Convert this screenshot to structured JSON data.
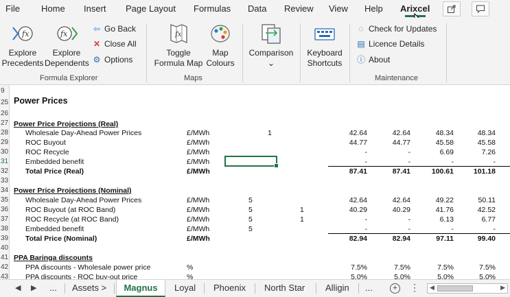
{
  "menu": {
    "tabs": [
      "File",
      "Home",
      "Insert",
      "Page Layout",
      "Formulas",
      "Data",
      "Review",
      "View",
      "Help",
      "Arixcel"
    ],
    "active": "Arixcel"
  },
  "ribbon": {
    "formula_explorer": {
      "explore_precedents": [
        "Explore",
        "Precedents"
      ],
      "explore_dependents": [
        "Explore",
        "Dependents"
      ],
      "go_back": "Go Back",
      "close_all": "Close All",
      "options": "Options",
      "group_label": "Formula Explorer"
    },
    "maps": {
      "toggle_formula_map": [
        "Toggle",
        "Formula Map"
      ],
      "map_colours": [
        "Map",
        "Colours"
      ],
      "group_label": "Maps"
    },
    "comparison": {
      "label": "Comparison",
      "arrow": "⌄"
    },
    "keyboard_shortcuts": [
      "Keyboard",
      "Shortcuts"
    ],
    "maintenance": {
      "check_updates": "Check for Updates",
      "licence_details": "Licence Details",
      "about": "About",
      "group_label": "Maintenance"
    }
  },
  "sheet": {
    "rows": [
      {
        "num": "9"
      },
      {
        "num": "25",
        "label": "Power Prices",
        "style": "bold-title"
      },
      {
        "num": "26"
      },
      {
        "num": "27",
        "label": "Power Price Projections (Real)",
        "style": "section"
      },
      {
        "num": "28",
        "label": "Wholesale Day-Ahead Power Prices",
        "unit": "£/MWh",
        "c1": "1",
        "v": [
          "42.64",
          "42.64",
          "48.34",
          "48.34"
        ]
      },
      {
        "num": "29",
        "label": "ROC Buyout",
        "unit": "£/MWh",
        "v": [
          "44.77",
          "44.77",
          "45.58",
          "45.58"
        ]
      },
      {
        "num": "30",
        "label": "ROC Recycle",
        "unit": "£/MWh",
        "v": [
          "-",
          "-",
          "6.69",
          "7.26"
        ]
      },
      {
        "num": "31",
        "label": "Embedded benefit",
        "unit": "£/MWh",
        "v": [
          "-",
          "-",
          "-",
          "-"
        ]
      },
      {
        "num": "32",
        "label": "Total Price (Real)",
        "unit": "£/MWh",
        "style": "total",
        "v": [
          "87.41",
          "87.41",
          "100.61",
          "101.18"
        ]
      },
      {
        "num": "33"
      },
      {
        "num": "34",
        "label": "Power Price Projections (Nominal)",
        "style": "section"
      },
      {
        "num": "35",
        "label": "Wholesale Day-Ahead Power Prices",
        "unit": "£/MWh",
        "c2": "5",
        "v": [
          "42.64",
          "42.64",
          "49.22",
          "50.11"
        ]
      },
      {
        "num": "36",
        "label": "ROC Buyout (at ROC Band)",
        "unit": "£/MWh",
        "c2": "5",
        "c3": "1",
        "v": [
          "40.29",
          "40.29",
          "41.76",
          "42.52"
        ]
      },
      {
        "num": "37",
        "label": "ROC Recycle (at ROC Band)",
        "unit": "£/MWh",
        "c2": "5",
        "c3": "1",
        "v": [
          "-",
          "-",
          "6.13",
          "6.77"
        ]
      },
      {
        "num": "38",
        "label": "Embedded benefit",
        "unit": "£/MWh",
        "c2": "5",
        "v": [
          "-",
          "-",
          "-",
          "-"
        ]
      },
      {
        "num": "39",
        "label": "Total Price (Nominal)",
        "unit": "£/MWh",
        "style": "total",
        "v": [
          "82.94",
          "82.94",
          "97.11",
          "99.40"
        ]
      },
      {
        "num": "40"
      },
      {
        "num": "41",
        "label": "PPA Baringa discounts",
        "style": "section"
      },
      {
        "num": "42",
        "label": "PPA discounts - Wholesale power price",
        "unit": "%",
        "v": [
          "7.5%",
          "7.5%",
          "7.5%",
          "7.5%"
        ]
      },
      {
        "num": "43",
        "label": "PPA discounts - ROC buy-out price",
        "unit": "%",
        "v": [
          "5.0%",
          "5.0%",
          "5.0%",
          "5.0%"
        ]
      }
    ]
  },
  "tabs": {
    "ellipsis": "...",
    "sheets": [
      "Assets >",
      "Magnus",
      "Loyal",
      "Phoenix",
      "North Star",
      "Alligin"
    ],
    "active": "Magnus",
    "add": "+"
  },
  "colors": {
    "accent": "#217346"
  },
  "icons": [
    "share-icon",
    "comment-icon",
    "explore-precedents-icon",
    "explore-dependents-icon",
    "go-back-icon",
    "close-all-icon",
    "options-gear-icon",
    "formula-map-icon",
    "map-colours-icon",
    "comparison-icon",
    "keyboard-icon",
    "check-updates-icon",
    "licence-icon",
    "about-icon",
    "cursor-icon"
  ]
}
